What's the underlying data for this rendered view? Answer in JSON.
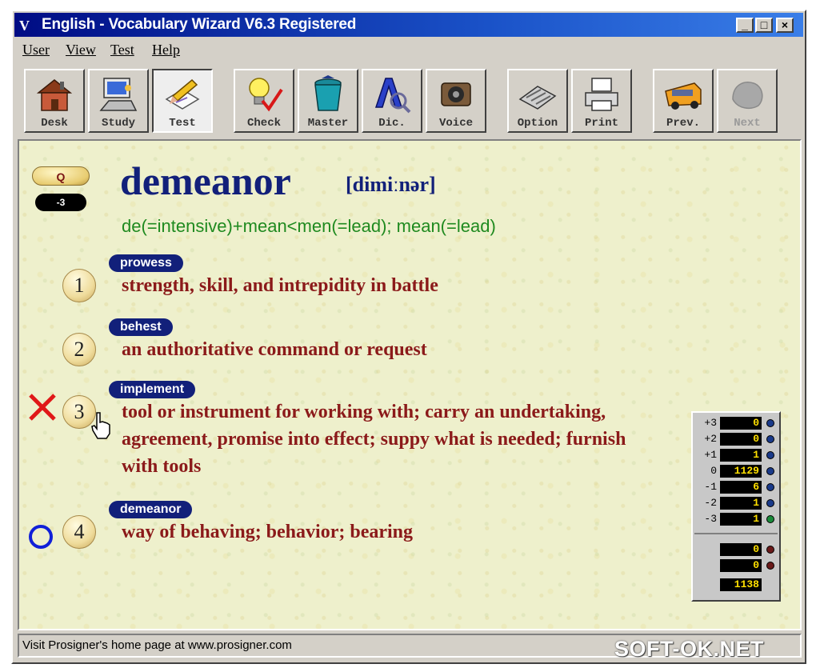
{
  "window": {
    "title": "English - Vocabulary Wizard V6.3 Registered",
    "app_icon": "V"
  },
  "controls": {
    "minimize": "_",
    "maximize": "□",
    "close": "×"
  },
  "menu": [
    "User",
    "View",
    "Test",
    "Help"
  ],
  "toolbar": [
    {
      "label": "Desk",
      "icon": "house-icon"
    },
    {
      "label": "Study",
      "icon": "computer-icon"
    },
    {
      "label": "Test",
      "icon": "pencil-paper-icon",
      "active": true
    },
    {
      "label": "Check",
      "icon": "lightbulb-check-icon"
    },
    {
      "label": "Master",
      "icon": "trash-bin-icon"
    },
    {
      "label": "Dic.",
      "icon": "dictionary-icon"
    },
    {
      "label": "Voice",
      "icon": "speaker-icon"
    },
    {
      "label": "Option",
      "icon": "keyboard-icon"
    },
    {
      "label": "Print",
      "icon": "printer-icon"
    },
    {
      "label": "Prev.",
      "icon": "bus-icon"
    },
    {
      "label": "Next",
      "icon": "next-disabled-icon",
      "disabled": true
    }
  ],
  "quiz": {
    "q_label": "Q",
    "score": "-3",
    "word": "demeanor",
    "phonetic": "[dimiːnər]",
    "etymology": "de(=intensive)+mean<men(=lead); mean(=lead)",
    "options": [
      {
        "number": "1",
        "tag": "prowess",
        "lines": [
          "strength, skill, and intrepidity in battle"
        ]
      },
      {
        "number": "2",
        "tag": "behest",
        "lines": [
          "an authoritative command or request"
        ]
      },
      {
        "number": "3",
        "tag": "implement",
        "lines": [
          "tool or instrument for working with; carry an undertaking,",
          "agreement, promise into effect; suppy what is needed; furnish",
          "with tools"
        ],
        "mark": "wrong"
      },
      {
        "number": "4",
        "tag": "demeanor",
        "lines": [
          "way of behaving; behavior; bearing"
        ],
        "mark": "correct"
      }
    ]
  },
  "stats": {
    "rows": [
      {
        "label": "+3",
        "value": "0"
      },
      {
        "label": "+2",
        "value": "0"
      },
      {
        "label": "+1",
        "value": "1"
      },
      {
        "label": "0",
        "value": "1129"
      },
      {
        "label": "-1",
        "value": "6"
      },
      {
        "label": "-2",
        "value": "1"
      },
      {
        "label": "-3",
        "value": "1"
      }
    ],
    "extra": [
      {
        "label": "",
        "value": "0"
      },
      {
        "label": "",
        "value": "0"
      },
      {
        "label": "",
        "value": "1138"
      }
    ]
  },
  "status": {
    "text": "Visit Prosigner's home page at www.prosigner.com"
  },
  "watermark": "SOFT-OK.NET",
  "colors": {
    "title_start": "#000c84",
    "word": "#12207a",
    "definition": "#8b1a1a",
    "etymology": "#1f8a1f",
    "wrong_mark": "#e01818",
    "correct_mark": "#1020d8"
  }
}
